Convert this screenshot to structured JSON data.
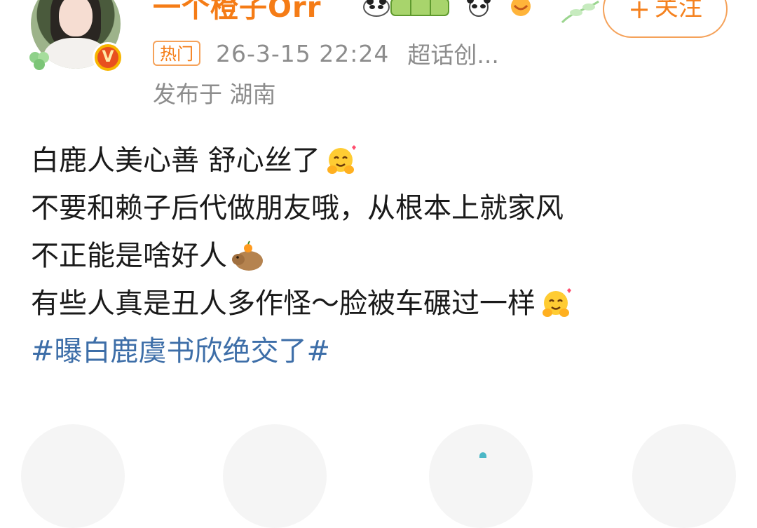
{
  "header": {
    "username": "一个橙子Orr",
    "follow_label": "关注",
    "follow_plus": "+",
    "hot_tag": "热门",
    "timestamp": "26-3-15 22:24",
    "source": "超话创...",
    "location": "发布于 湖南",
    "verified_badge": "V"
  },
  "post": {
    "lines": [
      "白鹿人美心善 舒心丝了",
      "不要和赖子后代做朋友哦，从根本上就家风",
      "不正能是啥好人",
      "有些人真是丑人多作怪～脸被车碾过一样"
    ],
    "topic": "#曝白鹿虞书欣绝交了#"
  },
  "icons": {
    "avatar": "avatar-photo",
    "badge": "verified-v-icon",
    "medals": [
      "panda-medal-icon",
      "bamboo-badge-icon",
      "panda-icon",
      "smile-emoji-icon"
    ],
    "line_emojis": [
      "hug-emoji-icon",
      "capybara-emoji-icon",
      "hug-emoji-icon"
    ]
  },
  "colors": {
    "username": "#f57c16",
    "topic": "#3d6ea8",
    "meta": "#8c8c8c",
    "follow_border": "#f5a25a"
  }
}
